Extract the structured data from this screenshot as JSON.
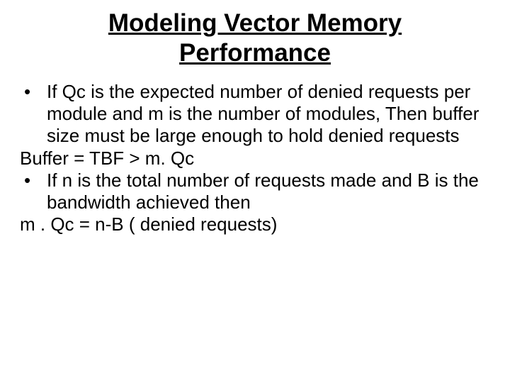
{
  "title": "Modeling Vector Memory Performance",
  "bullet_marker": "•",
  "lines": {
    "b1": "If Qc is the expected number of denied requests per module and m is the number of modules, Then buffer size must be large enough to hold denied requests",
    "p1": "Buffer = TBF > m. Qc",
    "b2": "If n is the total number of requests made and B is the bandwidth achieved then",
    "p2": "m . Qc = n-B ( denied requests)"
  }
}
